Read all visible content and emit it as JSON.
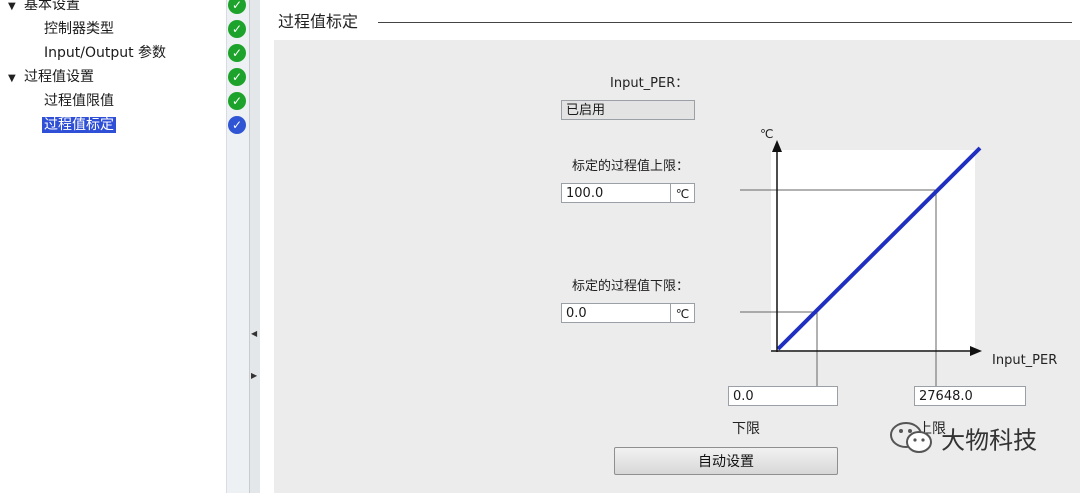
{
  "tree": {
    "items": [
      {
        "label": "基本设置",
        "arrow": "▼",
        "status": "ok"
      },
      {
        "label": "控制器类型",
        "arrow": "",
        "status": "ok"
      },
      {
        "label": "Input/Output 参数",
        "arrow": "",
        "status": "ok"
      },
      {
        "label": "过程值设置",
        "arrow": "▼",
        "status": "ok"
      },
      {
        "label": "过程值限值",
        "arrow": "",
        "status": "ok"
      },
      {
        "label": "过程值标定",
        "arrow": "",
        "status": "current"
      }
    ]
  },
  "section": {
    "title": "过程值标定"
  },
  "input_per": {
    "label": "Input_PER：",
    "value": "已启用"
  },
  "upper": {
    "label": "标定的过程值上限：",
    "value": "100.0",
    "unit": "℃"
  },
  "lower": {
    "label": "标定的过程值下限：",
    "value": "0.0",
    "unit": "℃"
  },
  "graph": {
    "y_unit": "℃",
    "x_label": "Input_PER"
  },
  "raw_lower": {
    "value": "0.0",
    "label": "下限"
  },
  "raw_upper": {
    "value": "27648.0",
    "label": "上限"
  },
  "button": {
    "auto_label": "自动设置"
  },
  "watermark": {
    "text": "大物科技"
  },
  "colors": {
    "line": "#1f2fbf",
    "ok": "#1da32b",
    "current": "#2f55d4",
    "selected": "#2f4fd6"
  }
}
